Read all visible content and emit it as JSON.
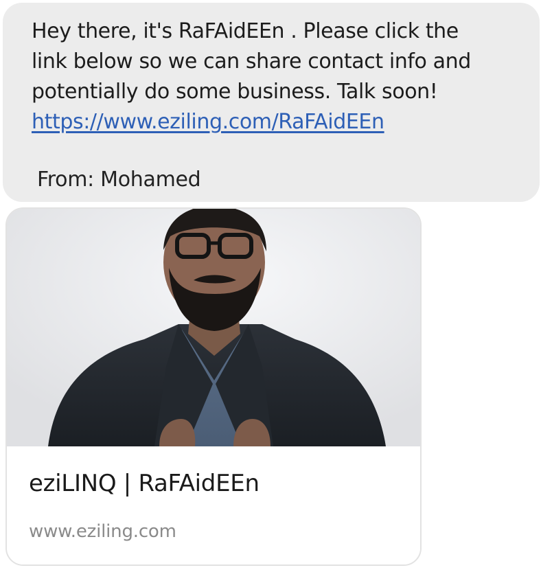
{
  "message": {
    "lines": [
      "Hey there, it's RaFAidEEn . Please click the",
      "link below so we can share contact info and",
      "potentially do some business. Talk soon!"
    ],
    "link": "https://www.eziling.com/RaFAidEEn",
    "sender": "From: Mohamed"
  },
  "link_preview": {
    "title": "eziLINQ | RaFAidEEn",
    "domain": "www.eziling.com"
  },
  "colors": {
    "bubble_background": "#ececec",
    "link": "#2d5fb6",
    "domain_text": "#8a8a8a"
  }
}
